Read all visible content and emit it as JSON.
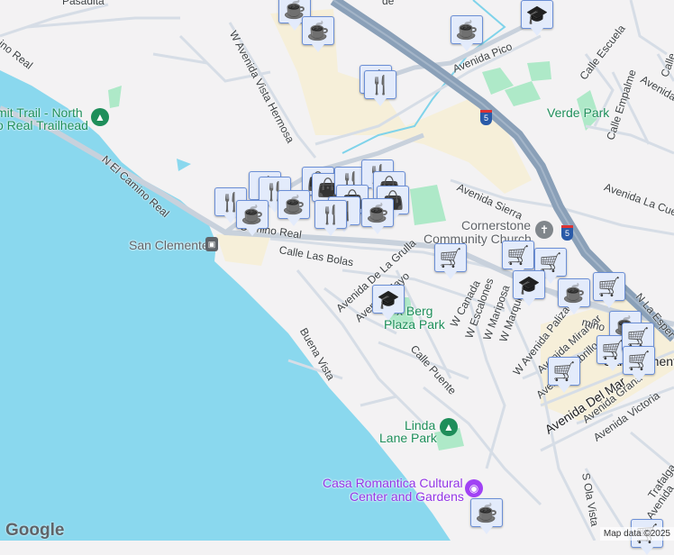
{
  "map": {
    "colors": {
      "water": "#8ad8ee",
      "land": "#f3f2f3",
      "freeway": "#8aa0b8",
      "road": "#d6dde6",
      "park": "#aee9c8",
      "commercial": "#f6efd9",
      "marker_bg": "#e3ebfb",
      "marker_icon": "#0b4a6e"
    },
    "streets": {
      "n_el_camino_real": "N El Camino Real",
      "el_camino_real_nw": "ino Real",
      "el_camino_real": "Camino Real",
      "el_camino_real_e": "mino",
      "w_avenida_vista_hermosa": "W Avenida Vista Hermosa",
      "avenida_pico": "Avenida Pico",
      "calle_escuela": "Calle Escuela",
      "calle_empalme": "Calle Empalme",
      "avenida_ne": "Avenida",
      "calle_ne": "Calle",
      "avenida_sierra": "Avenida Sierra",
      "avenida_la_cuesta": "Avenida La Cuest",
      "calle_las_bolas": "Calle Las Bolas",
      "avenida_de_la_grulla": "Avenida De La Grulla",
      "avenida_mayo": "Avenida Mayo",
      "buena_vista": "Buena Vista",
      "calle_puente": "Calle Puente",
      "w_canada": "W Canada",
      "w_escalones": "W Escalones",
      "w_mariposa": "W Mariposa",
      "w_marquita": "W Marquita",
      "w_avenida_palizada": "W Avenida Palizada",
      "avenida_miramar": "Avenida Miramar",
      "avenida_cabrillo": "Avenida Cabrillo",
      "avenida_del_mar": "Avenida Del Mar",
      "avenida_granada": "Avenida Grana",
      "avenida_victoria": "Avenida Victoria",
      "s_ola_vista": "S Ola Vista",
      "n_la_esperanza": "N La Esper",
      "trafalgar": "Trafalga",
      "avenida_se": "Avenida",
      "top_street_1": "Pasadita",
      "top_street_2": "de"
    },
    "pois": {
      "trailhead_1": "mit Trail - North",
      "trailhead_2": "o Real Trailhead",
      "san_clemente_station": "San Clemente",
      "verde_park": "Verde Park",
      "church_1": "Cornerstone",
      "church_2": "Community Church",
      "max_berg_1": "x Berg",
      "max_berg_2": "Plaza Park",
      "linda_lane_1": "Linda",
      "linda_lane_2": "Lane Park",
      "casa_romantica_1": "Casa Romantica Cultural",
      "casa_romantica_2": "Center and Gardens",
      "city": "San Clemente"
    },
    "highway_shield": "5",
    "attribution": "Map data ©2025",
    "logo": "Google"
  },
  "markers": [
    {
      "type": "coffee"
    },
    {
      "type": "coffee"
    },
    {
      "type": "coffee"
    },
    {
      "type": "school"
    },
    {
      "type": "restaurant"
    },
    {
      "type": "restaurant"
    },
    {
      "type": "restaurant"
    },
    {
      "type": "restaurant"
    },
    {
      "type": "shopping"
    },
    {
      "type": "shopping"
    },
    {
      "type": "restaurant"
    },
    {
      "type": "restaurant"
    },
    {
      "type": "shopping"
    },
    {
      "type": "shopping"
    },
    {
      "type": "restaurant"
    },
    {
      "type": "coffee"
    },
    {
      "type": "coffee"
    },
    {
      "type": "restaurant"
    },
    {
      "type": "shopping"
    },
    {
      "type": "restaurant"
    },
    {
      "type": "coffee"
    },
    {
      "type": "grocery"
    },
    {
      "type": "grocery"
    },
    {
      "type": "grocery"
    },
    {
      "type": "school"
    },
    {
      "type": "school"
    },
    {
      "type": "coffee"
    },
    {
      "type": "grocery"
    },
    {
      "type": "coffee"
    },
    {
      "type": "grocery"
    },
    {
      "type": "grocery"
    },
    {
      "type": "grocery"
    },
    {
      "type": "grocery"
    },
    {
      "type": "coffee"
    },
    {
      "type": "grocery"
    }
  ]
}
